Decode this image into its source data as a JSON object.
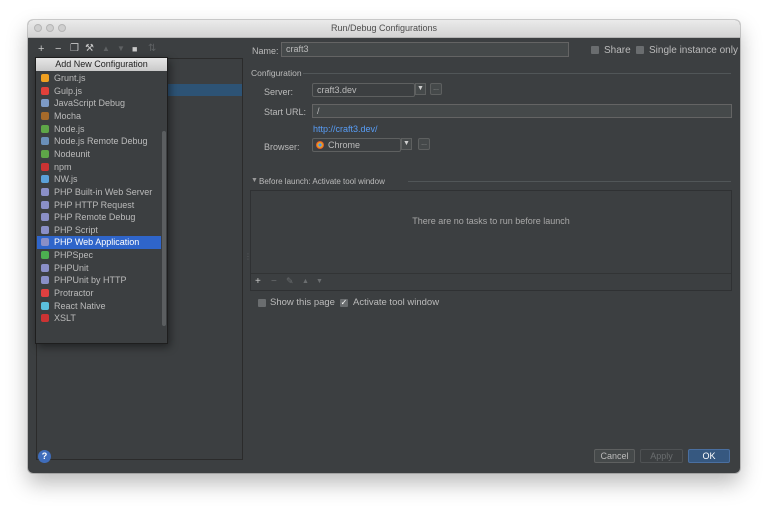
{
  "window": {
    "title": "Run/Debug Configurations"
  },
  "popup": {
    "title": "Add New Configuration",
    "items": [
      {
        "label": "Grunt.js",
        "color": "#f0a020"
      },
      {
        "label": "Gulp.js",
        "color": "#e0403a"
      },
      {
        "label": "JavaScript Debug",
        "color": "#7d9bc7"
      },
      {
        "label": "Mocha",
        "color": "#a66a2a"
      },
      {
        "label": "Node.js",
        "color": "#5ea648"
      },
      {
        "label": "Node.js Remote Debug",
        "color": "#6a8fb8"
      },
      {
        "label": "Nodeunit",
        "color": "#5ea648"
      },
      {
        "label": "npm",
        "color": "#cc3333"
      },
      {
        "label": "NW.js",
        "color": "#5aa0d8"
      },
      {
        "label": "PHP Built-in Web Server",
        "color": "#8a8fc7"
      },
      {
        "label": "PHP HTTP Request",
        "color": "#8a8fc7"
      },
      {
        "label": "PHP Remote Debug",
        "color": "#8a8fc7"
      },
      {
        "label": "PHP Script",
        "color": "#8a8fc7"
      },
      {
        "label": "PHP Web Application",
        "color": "#8a8fc7"
      },
      {
        "label": "PHPSpec",
        "color": "#4caf50"
      },
      {
        "label": "PHPUnit",
        "color": "#8a8fc7"
      },
      {
        "label": "PHPUnit by HTTP",
        "color": "#8a8fc7"
      },
      {
        "label": "Protractor",
        "color": "#e04040"
      },
      {
        "label": "React Native",
        "color": "#5bc0de"
      },
      {
        "label": "XSLT",
        "color": "#cc3333"
      }
    ],
    "selected_index": 13
  },
  "form": {
    "name_label": "Name:",
    "name_value": "craft3",
    "share_label": "Share",
    "single_instance_label": "Single instance only",
    "section_title": "Configuration",
    "server_label": "Server:",
    "server_value": "craft3.dev",
    "start_url_label": "Start URL:",
    "start_url_value": "/",
    "url_link": "http://craft3.dev/",
    "browser_label": "Browser:",
    "browser_value": "Chrome"
  },
  "before_launch": {
    "title": "Before launch: Activate tool window",
    "empty_text": "There are no tasks to run before launch"
  },
  "options": {
    "show_page_label": "Show this page",
    "show_page_checked": false,
    "activate_label": "Activate tool window",
    "activate_checked": true
  },
  "buttons": {
    "help": "?",
    "cancel": "Cancel",
    "apply": "Apply",
    "ok": "OK"
  },
  "colors": {
    "selection": "#2f65ca",
    "link": "#589df6",
    "ok_button": "#365880"
  }
}
